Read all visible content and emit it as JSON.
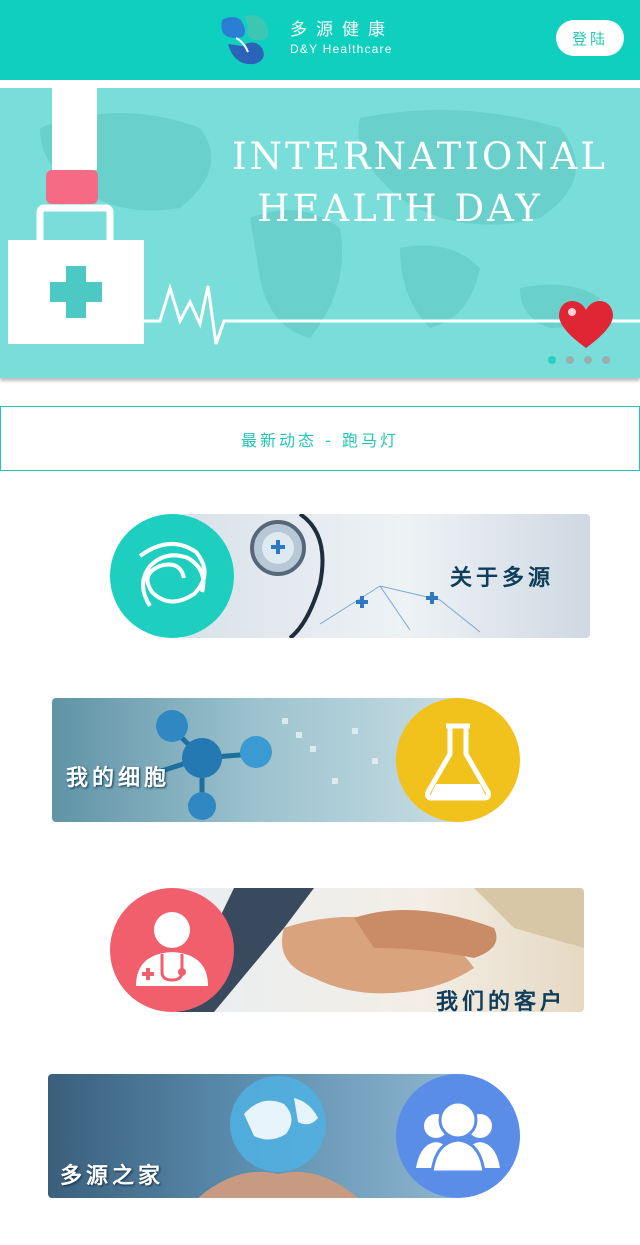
{
  "header": {
    "brand_cn": "多源健康",
    "brand_en": "D&Y Healthcare",
    "login_label": "登陆"
  },
  "banner": {
    "title_line1": "INTERNATIONAL",
    "title_line2": "HEALTH DAY",
    "slide_count": 4,
    "active_slide": 1
  },
  "marquee": {
    "text": "最新动态 - 跑马灯"
  },
  "cards": [
    {
      "label": "关于多源",
      "icon": "knot-logo-icon",
      "color": "#1ecfbf"
    },
    {
      "label": "我的细胞",
      "icon": "flask-icon",
      "color": "#f1c21b"
    },
    {
      "label": "我们的客户",
      "icon": "doctor-icon",
      "color": "#f15e6c"
    },
    {
      "label": "多源之家",
      "icon": "family-icon",
      "color": "#5a8de8"
    }
  ]
}
